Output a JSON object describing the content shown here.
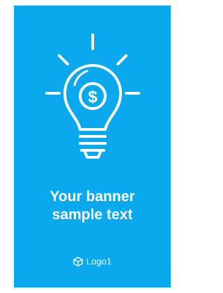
{
  "banner": {
    "background_color": "#0aa8ec",
    "icon": "lightbulb-dollar-icon",
    "headline_line1": "Your banner",
    "headline_line2": "sample text",
    "logo_icon": "cube-icon",
    "logo_text": "Logo1"
  }
}
